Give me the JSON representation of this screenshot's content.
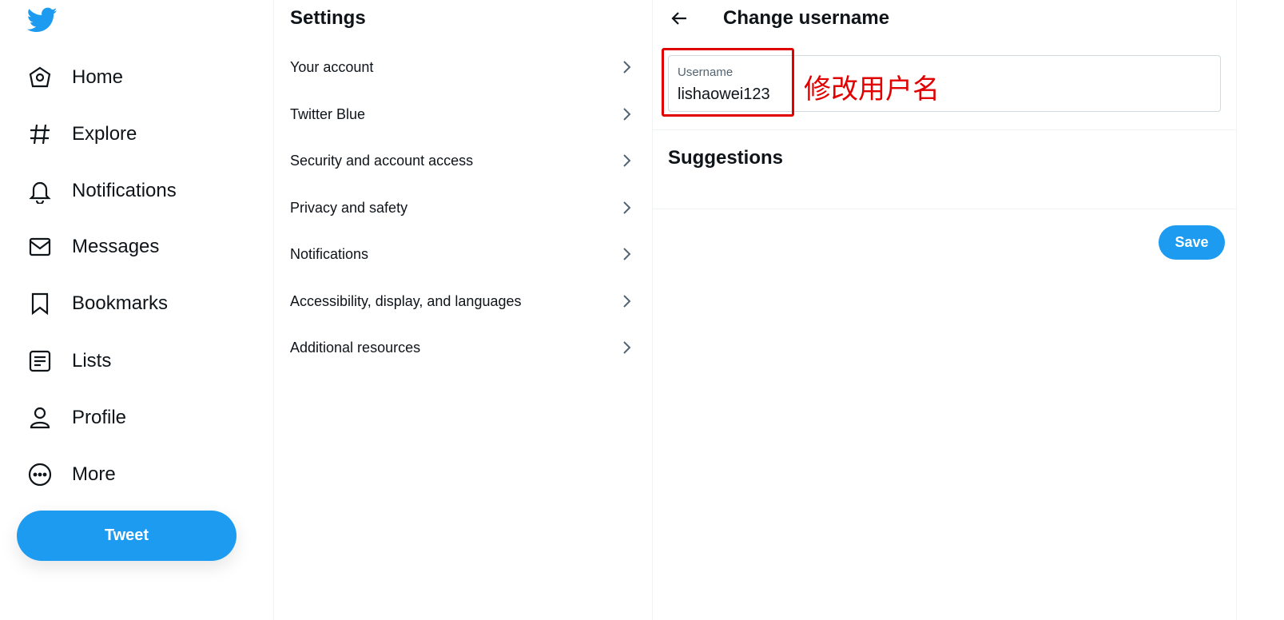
{
  "colors": {
    "accent": "#1d9bf0",
    "annotation": "#e00000",
    "text": "#0f1419",
    "muted": "#536471"
  },
  "nav": {
    "logo_icon": "twitter-bird-icon",
    "items": [
      {
        "label": "Home",
        "icon": "home-icon"
      },
      {
        "label": "Explore",
        "icon": "hashtag-icon"
      },
      {
        "label": "Notifications",
        "icon": "bell-icon"
      },
      {
        "label": "Messages",
        "icon": "envelope-icon"
      },
      {
        "label": "Bookmarks",
        "icon": "bookmark-icon"
      },
      {
        "label": "Lists",
        "icon": "list-icon"
      },
      {
        "label": "Profile",
        "icon": "person-icon"
      },
      {
        "label": "More",
        "icon": "more-circle-icon"
      }
    ],
    "tweet_label": "Tweet"
  },
  "settings": {
    "title": "Settings",
    "items": [
      {
        "label": "Your account"
      },
      {
        "label": "Twitter Blue"
      },
      {
        "label": "Security and account access"
      },
      {
        "label": "Privacy and safety"
      },
      {
        "label": "Notifications"
      },
      {
        "label": "Accessibility, display, and languages"
      },
      {
        "label": "Additional resources"
      }
    ]
  },
  "detail": {
    "title": "Change username",
    "field_label": "Username",
    "field_value": "lishaowei123",
    "annotation": "修改用户名",
    "suggestions_title": "Suggestions",
    "save_label": "Save"
  }
}
